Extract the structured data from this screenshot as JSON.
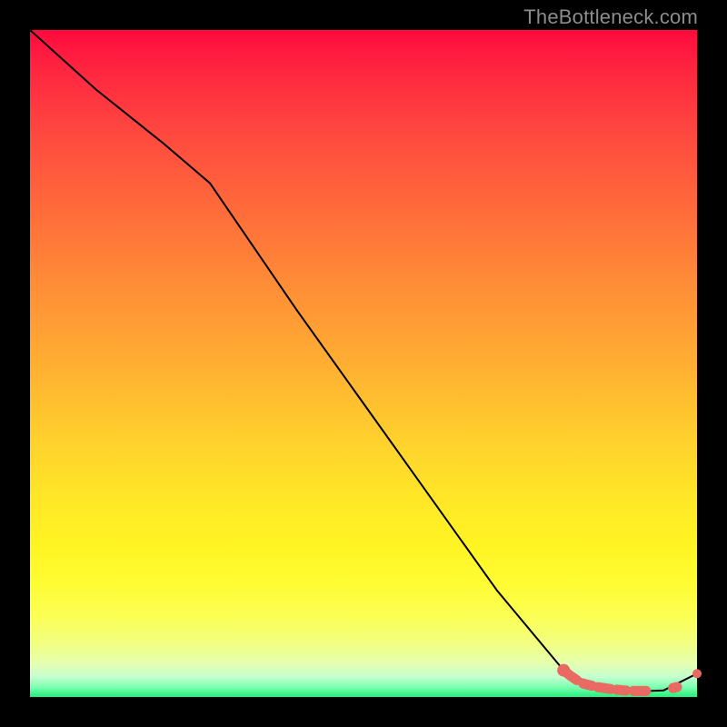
{
  "watermark": "TheBottleneck.com",
  "chart_data": {
    "type": "line",
    "title": "",
    "xlabel": "",
    "ylabel": "",
    "xlim": [
      0,
      100
    ],
    "ylim": [
      0,
      100
    ],
    "grid": false,
    "legend": false,
    "series": [
      {
        "name": "black-line",
        "color": "#000000",
        "x": [
          0,
          10,
          20,
          27,
          40,
          50,
          60,
          70,
          80,
          85,
          90,
          95,
          100
        ],
        "values": [
          100,
          91,
          83,
          77,
          58,
          44,
          30,
          16,
          4,
          1.5,
          0.8,
          1.0,
          3.5
        ]
      },
      {
        "name": "coral-markers",
        "color": "#e86a63",
        "x": [
          80,
          81,
          82,
          83,
          85,
          87,
          88,
          89,
          91,
          92,
          93,
          95,
          97
        ],
        "values": [
          4.0,
          3.2,
          2.5,
          2.0,
          1.5,
          1.2,
          1.1,
          1.0,
          0.9,
          0.9,
          0.9,
          1.0,
          1.5
        ]
      },
      {
        "name": "coral-end-dot",
        "color": "#e86a63",
        "x": [
          100
        ],
        "values": [
          3.5
        ]
      }
    ]
  }
}
